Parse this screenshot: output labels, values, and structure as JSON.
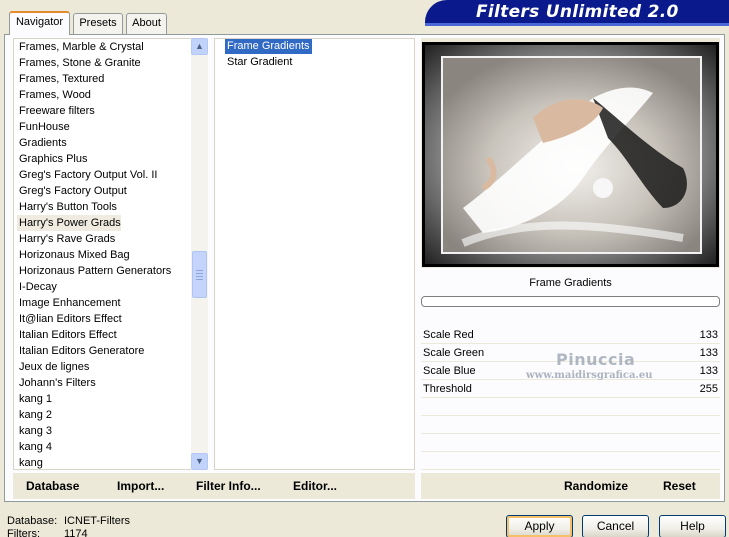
{
  "tabs": [
    {
      "label": "Navigator",
      "active": true
    },
    {
      "label": "Presets",
      "active": false
    },
    {
      "label": "About",
      "active": false
    }
  ],
  "banner": {
    "title": "Filters Unlimited 2.0"
  },
  "categories": [
    "Frames, Marble & Crystal",
    "Frames, Stone & Granite",
    "Frames, Textured",
    "Frames, Wood",
    "Freeware filters",
    "FunHouse",
    "Gradients",
    "Graphics Plus",
    "Greg's Factory Output Vol. II",
    "Greg's Factory Output",
    "Harry's Button Tools",
    "Harry's Power Grads",
    "Harry's Rave Grads",
    "Horizonaus Mixed Bag",
    "Horizonaus Pattern Generators",
    "I-Decay",
    "Image Enhancement",
    "It@lian Editors Effect",
    "Italian Editors Effect",
    "Italian Editors Generatore",
    "Jeux de lignes",
    "Johann's Filters",
    "kang 1",
    "kang 2",
    "kang 3",
    "kang 4",
    "kang"
  ],
  "selected_category": "Harry's Power Grads",
  "filters": [
    "Frame Gradients",
    "Star Gradient"
  ],
  "selected_filter": "Frame Gradients",
  "preview": {
    "filter_title": "Frame Gradients"
  },
  "params": [
    {
      "label": "Scale Red",
      "value": "133"
    },
    {
      "label": "Scale Green",
      "value": "133"
    },
    {
      "label": "Scale Blue",
      "value": "133"
    },
    {
      "label": "Threshold",
      "value": "255"
    }
  ],
  "watermark": {
    "name": "Pinuccia",
    "url": "www.maidirsgrafica.eu"
  },
  "toolbar": {
    "database": "Database",
    "import": "Import...",
    "filter_info": "Filter Info...",
    "editor": "Editor...",
    "randomize": "Randomize",
    "reset": "Reset"
  },
  "status": {
    "database_label": "Database:",
    "database_value": "ICNET-Filters",
    "filters_label": "Filters:",
    "filters_value": "1174"
  },
  "buttons": {
    "apply": "Apply",
    "cancel": "Cancel",
    "help": "Help"
  },
  "icons": {
    "scroll_up": "chevron-up-icon",
    "scroll_down": "chevron-down-icon"
  },
  "colors": {
    "banner": "#0a1a8c",
    "selection": "#316ac5",
    "tab_accent": "#e68b2c"
  }
}
